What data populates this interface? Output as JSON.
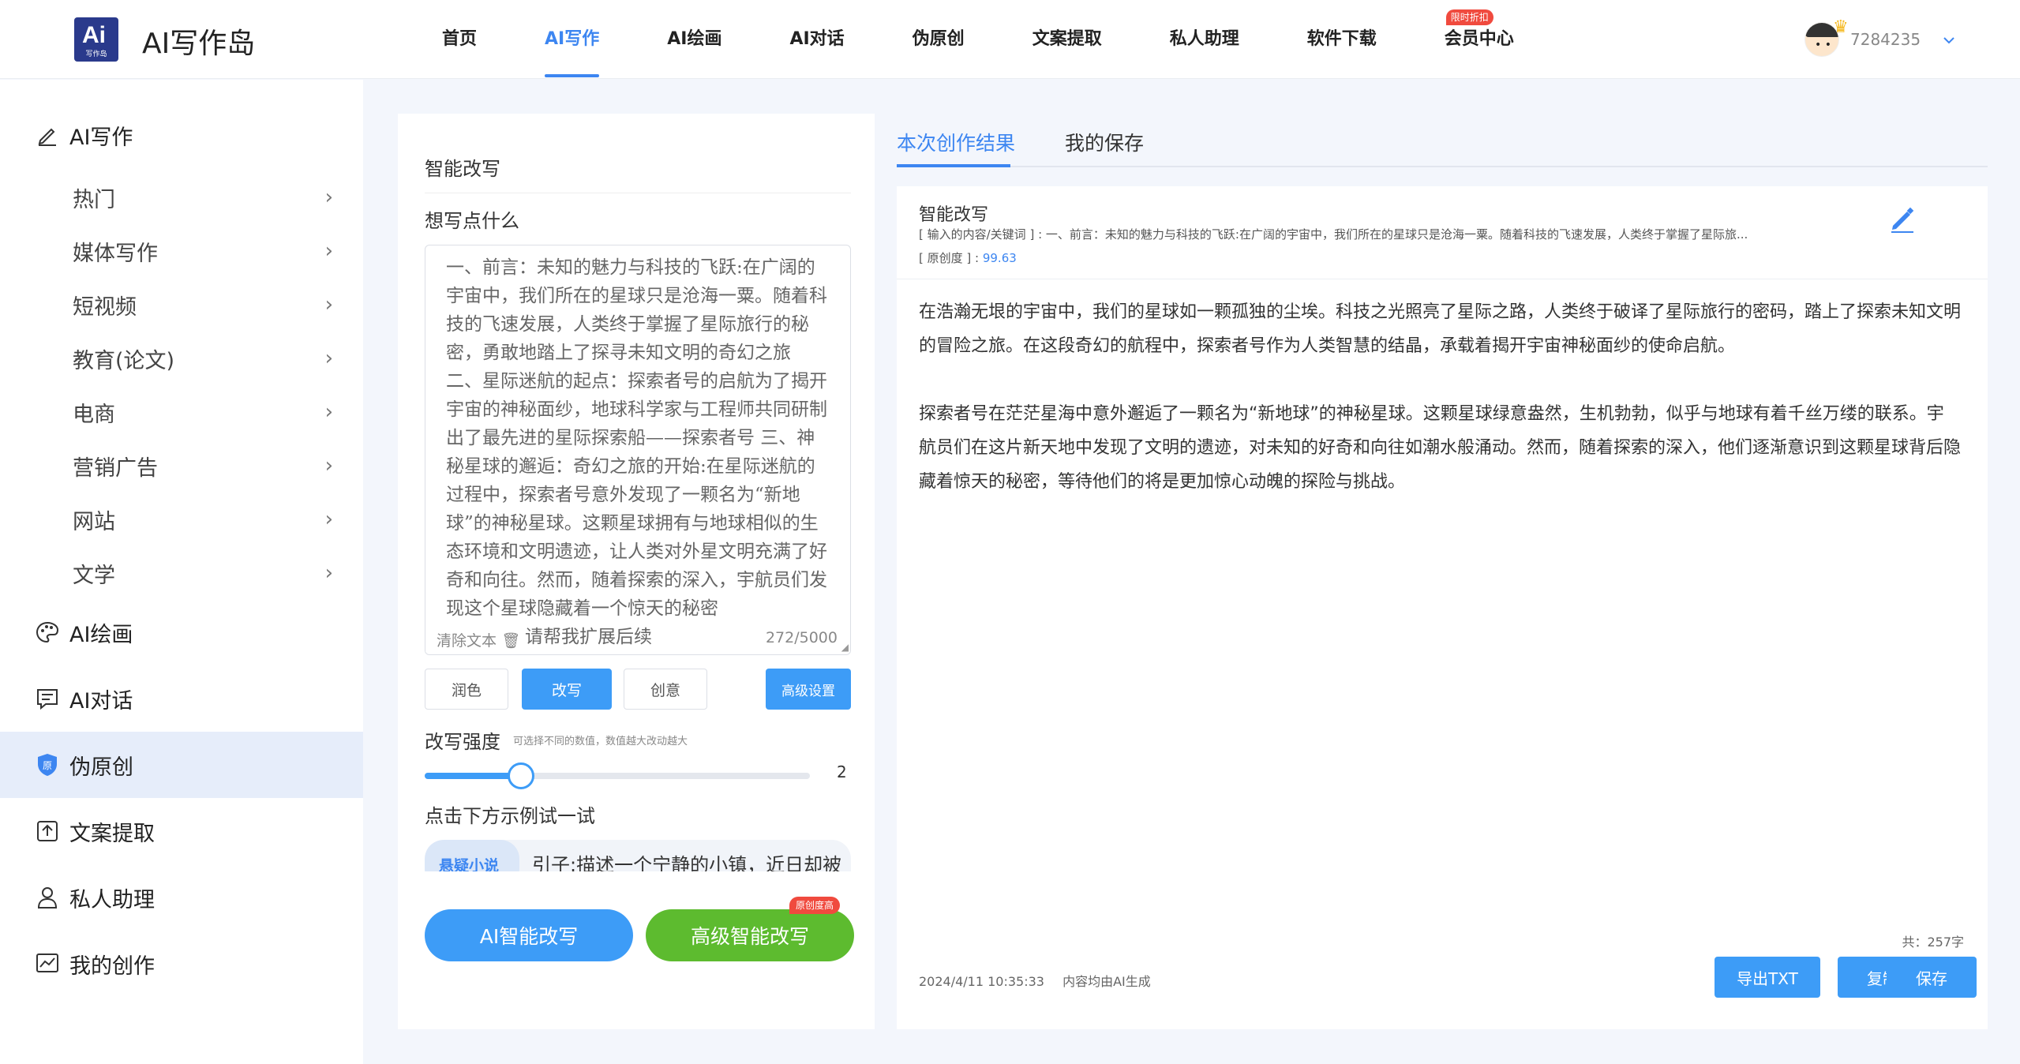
{
  "header": {
    "logo_mark": "Ai",
    "logo_caption": "写作岛",
    "title": "AI写作岛",
    "nav": [
      {
        "label": "首页",
        "active": false
      },
      {
        "label": "AI写作",
        "active": true
      },
      {
        "label": "AI绘画",
        "active": false
      },
      {
        "label": "AI对话",
        "active": false
      },
      {
        "label": "伪原创",
        "active": false
      },
      {
        "label": "文案提取",
        "active": false
      },
      {
        "label": "私人助理",
        "active": false
      },
      {
        "label": "软件下载",
        "active": false
      },
      {
        "label": "会员中心",
        "active": false,
        "badge": "限时折扣"
      }
    ],
    "user": {
      "id": "7284235",
      "caret_icon": "chevron-down-icon"
    }
  },
  "sidebar": {
    "sections": [
      {
        "label": "AI写作",
        "icon": "pencil-icon"
      },
      {
        "label": "AI绘画",
        "icon": "palette-icon"
      },
      {
        "label": "AI对话",
        "icon": "chat-icon"
      },
      {
        "label": "伪原创",
        "icon": "shield-icon",
        "active": true
      },
      {
        "label": "文案提取",
        "icon": "upload-icon"
      },
      {
        "label": "私人助理",
        "icon": "user-icon"
      },
      {
        "label": "我的创作",
        "icon": "chart-icon"
      }
    ],
    "subitems": [
      "热门",
      "媒体写作",
      "短视频",
      "教育(论文)",
      "电商",
      "营销广告",
      "网站",
      "文学"
    ]
  },
  "editor": {
    "title": "智能改写",
    "prompt_label": "想写点什么",
    "input_text": "一、前言：未知的魅力与科技的飞跃:在广阔的宇宙中，我们所在的星球只是沧海一粟。随着科技的飞速发展，人类终于掌握了星际旅行的秘密，勇敢地踏上了探寻未知文明的奇幻之旅 二、星际迷航的起点：探索者号的启航为了揭开宇宙的神秘面纱，地球科学家与工程师共同研制出了最先进的星际探索船——探索者号 三、神秘星球的邂逅：奇幻之旅的开始:在星际迷航的过程中，探索者号意外发现了一颗名为“新地球”的神秘星球。这颗星球拥有与地球相似的生态环境和文明遗迹，让人类对外星文明充满了好奇和向往。然而，随着探索的深入，宇航员们发现这个星球隐藏着一个惊天的秘密",
    "placeholder": "请帮我扩展后续",
    "clear_label": "清除文本",
    "char_count": "272/5000",
    "modes": [
      {
        "label": "润色",
        "active": false
      },
      {
        "label": "改写",
        "active": true
      },
      {
        "label": "创意",
        "active": false
      }
    ],
    "advanced_label": "高级设置",
    "strength_label": "改写强度",
    "strength_hint": "可选择不同的数值，数值越大改动越大",
    "strength_value": "2",
    "strength_fraction": 0.25,
    "example_label": "点击下方示例试一试",
    "example_tag": "悬疑小说",
    "example_text": "引子:描述一个宁静的小镇，近日却被",
    "cta_primary": "AI智能改写",
    "cta_secondary": "高级智能改写",
    "cta_badge": "原创度高"
  },
  "result": {
    "tabs": [
      {
        "label": "本次创作结果",
        "active": true
      },
      {
        "label": "我的保存",
        "active": false
      }
    ],
    "title": "智能改写",
    "input_summary": "[ 输入的内容/关键词 ] : 一、前言：未知的魅力与科技的飞跃:在广阔的宇宙中，我们所在的星球只是沧海一粟。随着科技的飞速发展，人类终于掌握了星际旅...",
    "originality_label": "[ 原创度 ] :",
    "originality_value": "99.63",
    "paragraphs": [
      "在浩瀚无垠的宇宙中，我们的星球如一颗孤独的尘埃。科技之光照亮了星际之路，人类终于破译了星际旅行的密码，踏上了探索未知文明的冒险之旅。在这段奇幻的航程中，探索者号作为人类智慧的结晶，承载着揭开宇宙神秘面纱的使命启航。",
      "探索者号在茫茫星海中意外邂逅了一颗名为“新地球”的神秘星球。这颗星球绿意盎然，生机勃勃，似乎与地球有着千丝万缕的联系。宇航员们在这片新天地中发现了文明的遗迹，对未知的好奇和向往如潮水般涌动。然而，随着探索的深入，他们逐渐意识到这颗星球背后隐藏着惊天的秘密，等待他们的将是更加惊心动魄的探险与挑战。"
    ],
    "char_total": "共：257字",
    "timestamp": "2024/4/11 10:35:33",
    "ai_note": "内容均由AI生成",
    "actions": [
      "导出TXT",
      "复制",
      "保存"
    ]
  },
  "colors": {
    "accent": "#3d86f1",
    "button_blue": "#3d9cf7",
    "button_green": "#5dbb2f",
    "badge_red": "#f04a3e"
  }
}
